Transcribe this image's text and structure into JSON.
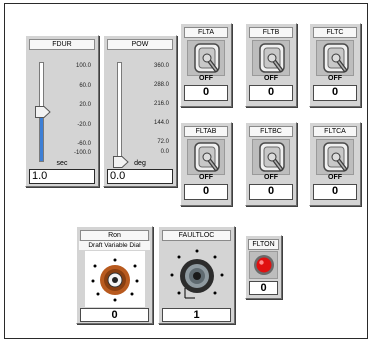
{
  "sliders": [
    {
      "title": "FDUR",
      "ticks": [
        "100.0",
        "60.0",
        "20.0",
        "-20.0",
        "-60.0",
        "-100.0"
      ],
      "unit": "sec",
      "value": "1.0",
      "fraction": 0.505
    },
    {
      "title": "POW",
      "ticks": [
        "360.0",
        "288.0",
        "216.0",
        "144.0",
        "72.0",
        "0.0"
      ],
      "unit": "deg",
      "value": "0.0",
      "fraction": 0.0
    }
  ],
  "switches": [
    {
      "title": "FLTA",
      "state": "OFF",
      "value": "0"
    },
    {
      "title": "FLTB",
      "state": "OFF",
      "value": "0"
    },
    {
      "title": "FLTC",
      "state": "OFF",
      "value": "0"
    },
    {
      "title": "FLTAB",
      "state": "OFF",
      "value": "0"
    },
    {
      "title": "FLTBC",
      "state": "OFF",
      "value": "0"
    },
    {
      "title": "FLTCA",
      "state": "OFF",
      "value": "0"
    }
  ],
  "dials": [
    {
      "title": "Ron",
      "subtitle": "Draft Variable Dial",
      "value": "0"
    },
    {
      "title": "FAULTLOC",
      "subtitle": "",
      "value": "1"
    }
  ],
  "button": {
    "title": "FLTON",
    "value": "0",
    "color": "#e01010"
  },
  "colors": {
    "panel": "#d4d4d4",
    "accent": "#3d7fd6",
    "dial": "#b85a1e"
  }
}
